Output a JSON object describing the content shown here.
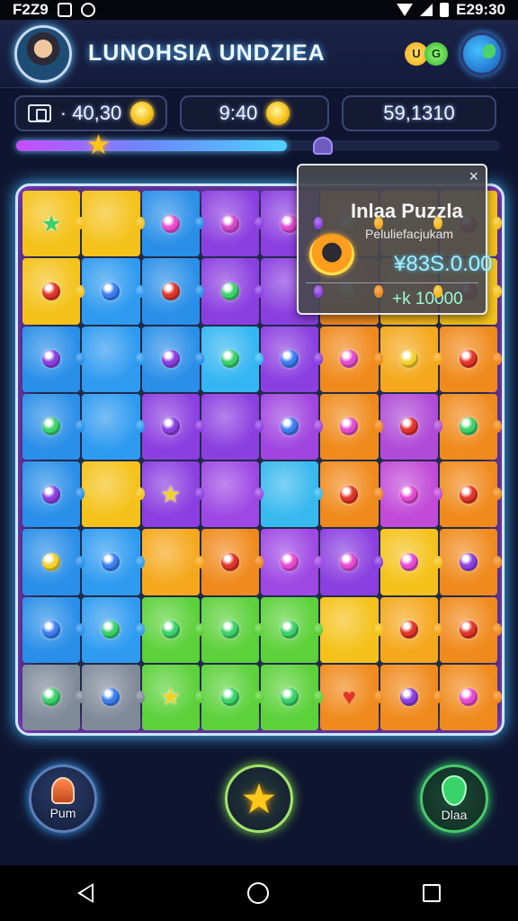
{
  "status_bar": {
    "time_left": "F2Z9",
    "time_right": "E29:30"
  },
  "header": {
    "title": "LUNOHSIA UNDZIEA",
    "coin_a": "U",
    "coin_b": "G"
  },
  "stats": {
    "tickets": "· 40,30",
    "time": "9:40",
    "score": "59,1310"
  },
  "progress": {
    "fraction": 0.56
  },
  "offer": {
    "title": "Inlaa Puzzla",
    "subtitle": "Peluliefacjukam",
    "price": "¥83S.0.00",
    "bonus": "+k 10000",
    "close": "×"
  },
  "actions": {
    "left_label": "Pum",
    "right_label": "Dlaa"
  },
  "colors": {
    "background": "#0f1530",
    "accent": "#46b9ff",
    "board_glow": "#b03cff"
  },
  "icons": {
    "status": [
      "key-icon",
      "circle-icon",
      "wifi-icon",
      "signal-icon",
      "battery-icon"
    ],
    "header": [
      "avatar",
      "coin-icon",
      "globe-icon"
    ],
    "actions": [
      "person-icon",
      "star-icon",
      "shield-icon"
    ],
    "nav": [
      "back-icon",
      "home-icon",
      "recents-icon"
    ]
  },
  "board": {
    "rows": [
      [
        {
          "c": "#f4c21a",
          "g": "#3ad16a",
          "s": "star"
        },
        {
          "c": "#f4c21a",
          "g": null
        },
        {
          "c": "#2a8fe8",
          "g": "#e94bd0",
          "s": "dot"
        },
        {
          "c": "#8b3fe0",
          "g": "#d448c8",
          "s": "dot"
        },
        {
          "c": "#8b3fe0",
          "g": "#e54ad2",
          "s": "dot"
        },
        {
          "c": "#f5a81c",
          "g": "#f3d12a",
          "s": "dot"
        },
        {
          "c": "#f5b81c",
          "g": null
        },
        {
          "c": "#f4c21a",
          "g": "#e23a2a",
          "s": "dot"
        }
      ],
      [
        {
          "c": "#f4c21a",
          "g": "#e0342a",
          "s": "dot"
        },
        {
          "c": "#2f9bf0",
          "g": "#3a7ef0",
          "s": "dot"
        },
        {
          "c": "#2a8fe8",
          "g": "#e0342a",
          "s": "dot"
        },
        {
          "c": "#8b3fe0",
          "g": "#3ad16a",
          "s": "dot"
        },
        {
          "c": "#8b3fe0",
          "g": null
        },
        {
          "c": "#f08a1c",
          "g": "#f3d12a",
          "s": "dot"
        },
        {
          "c": "#f5b81c",
          "g": null
        },
        {
          "c": "#f4c21a",
          "g": "#e0342a",
          "s": "dot"
        }
      ],
      [
        {
          "c": "#2a8fe8",
          "g": "#8b3fe0",
          "s": "dot"
        },
        {
          "c": "#2f9bf0",
          "g": null
        },
        {
          "c": "#2a8fe8",
          "g": "#8b3fe0",
          "s": "dot"
        },
        {
          "c": "#34b6f2",
          "g": "#3ad16a",
          "s": "dot"
        },
        {
          "c": "#8b3fe0",
          "g": "#3a7ef0",
          "s": "dot"
        },
        {
          "c": "#f08a1c",
          "g": "#e54ad2",
          "s": "dot"
        },
        {
          "c": "#f5a81c",
          "g": "#f3d12a",
          "s": "dot"
        },
        {
          "c": "#f08a1c",
          "g": "#e0342a",
          "s": "dot"
        }
      ],
      [
        {
          "c": "#2a8fe8",
          "g": "#3ad16a",
          "s": "dot"
        },
        {
          "c": "#2f9bf0",
          "g": null
        },
        {
          "c": "#8b3fe0",
          "g": "#8b3fe0",
          "s": "dot"
        },
        {
          "c": "#8b3fe0",
          "g": null
        },
        {
          "c": "#a045e0",
          "g": "#3a7ef0",
          "s": "dot"
        },
        {
          "c": "#f08a1c",
          "g": "#e54ad2",
          "s": "dot"
        },
        {
          "c": "#b04ad8",
          "g": "#e0342a",
          "s": "dot"
        },
        {
          "c": "#f08a1c",
          "g": "#3ad16a",
          "s": "dot"
        }
      ],
      [
        {
          "c": "#2a8fe8",
          "g": "#8b3fe0",
          "s": "dot"
        },
        {
          "c": "#f4c21a",
          "g": null
        },
        {
          "c": "#8b3fe0",
          "g": "#f3d12a",
          "s": "star"
        },
        {
          "c": "#9e48e4",
          "g": null
        },
        {
          "c": "#38b9ee",
          "g": null
        },
        {
          "c": "#f08a1c",
          "g": "#e0342a",
          "s": "dot"
        },
        {
          "c": "#c24ad8",
          "g": "#e54ad2",
          "s": "dot"
        },
        {
          "c": "#f08a1c",
          "g": "#e0342a",
          "s": "dot"
        }
      ],
      [
        {
          "c": "#2a8fe8",
          "g": "#f3d12a",
          "s": "dot"
        },
        {
          "c": "#2f9bf0",
          "g": "#3a7ef0",
          "s": "dot"
        },
        {
          "c": "#f5a81c",
          "g": null
        },
        {
          "c": "#f08a1c",
          "g": "#e0342a",
          "s": "dot"
        },
        {
          "c": "#9e48e4",
          "g": "#e54ad2",
          "s": "dot"
        },
        {
          "c": "#8b3fe0",
          "g": "#e54ad2",
          "s": "dot"
        },
        {
          "c": "#f4c21a",
          "g": "#e54ad2",
          "s": "dot"
        },
        {
          "c": "#f08a1c",
          "g": "#8b3fe0",
          "s": "dot"
        }
      ],
      [
        {
          "c": "#2a8fe8",
          "g": "#3a7ef0",
          "s": "dot"
        },
        {
          "c": "#2f9bf0",
          "g": "#3ad16a",
          "s": "dot"
        },
        {
          "c": "#5cd13a",
          "g": "#3ad16a",
          "s": "dot"
        },
        {
          "c": "#5cd13a",
          "g": "#3ad16a",
          "s": "dot"
        },
        {
          "c": "#5cd13a",
          "g": "#3ad16a",
          "s": "dot"
        },
        {
          "c": "#f4c21a",
          "g": null
        },
        {
          "c": "#f5a81c",
          "g": "#e0342a",
          "s": "dot"
        },
        {
          "c": "#f08a1c",
          "g": "#e0342a",
          "s": "dot"
        }
      ],
      [
        {
          "c": "#7f8a99",
          "g": "#3ad16a",
          "s": "dot"
        },
        {
          "c": "#7f8a99",
          "g": "#3a7ef0",
          "s": "dot"
        },
        {
          "c": "#5cd13a",
          "g": "#f3d12a",
          "s": "star"
        },
        {
          "c": "#5cd13a",
          "g": "#3ad16a",
          "s": "dot"
        },
        {
          "c": "#5cd13a",
          "g": "#3ad16a",
          "s": "dot"
        },
        {
          "c": "#f08a1c",
          "g": "#e0342a",
          "s": "heart"
        },
        {
          "c": "#f08a1c",
          "g": "#8b3fe0",
          "s": "dot"
        },
        {
          "c": "#f08a1c",
          "g": "#e54ad2",
          "s": "dot"
        }
      ]
    ]
  }
}
